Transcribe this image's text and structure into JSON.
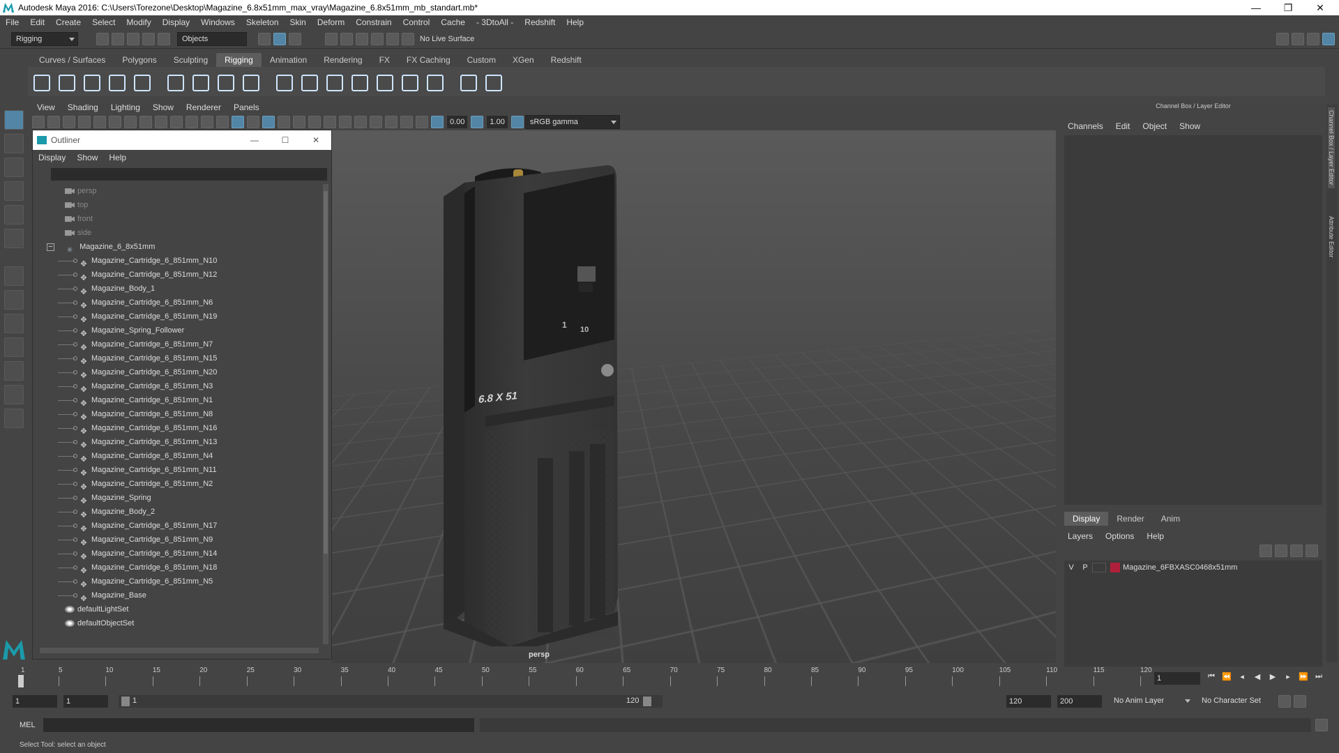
{
  "app": {
    "title": "Autodesk Maya 2016: C:\\Users\\Torezone\\Desktop\\Magazine_6.8x51mm_max_vray\\Magazine_6.8x51mm_mb_standart.mb*",
    "min": "—",
    "max": "❐",
    "close": "✕"
  },
  "menubar": [
    "File",
    "Edit",
    "Create",
    "Select",
    "Modify",
    "Display",
    "Windows",
    "Skeleton",
    "Skin",
    "Deform",
    "Constrain",
    "Control",
    "Cache",
    "- 3DtoAll -",
    "Redshift",
    "Help"
  ],
  "statusline": {
    "mode": "Rigging",
    "selection_mode": "Objects",
    "live_surface": "No Live Surface"
  },
  "shelf_tabs": [
    "Curves / Surfaces",
    "Polygons",
    "Sculpting",
    "Rigging",
    "Animation",
    "Rendering",
    "FX",
    "FX Caching",
    "Custom",
    "XGen",
    "Redshift"
  ],
  "shelf_active": "Rigging",
  "panel_menu": [
    "View",
    "Shading",
    "Lighting",
    "Show",
    "Renderer",
    "Panels"
  ],
  "panel_toolbar": {
    "exposure": "0.00",
    "gamma": "1.00",
    "color_space": "sRGB gamma"
  },
  "viewport": {
    "camera": "persp",
    "mag_label": "6.8 X 51",
    "mark_1": "1",
    "mark_10": "10"
  },
  "outliner": {
    "title": "Outliner",
    "menu": [
      "Display",
      "Show",
      "Help"
    ],
    "cameras": [
      "persp",
      "top",
      "front",
      "side"
    ],
    "group": "Magazine_6_8x51mm",
    "children": [
      "Magazine_Cartridge_6_851mm_N10",
      "Magazine_Cartridge_6_851mm_N12",
      "Magazine_Body_1",
      "Magazine_Cartridge_6_851mm_N6",
      "Magazine_Cartridge_6_851mm_N19",
      "Magazine_Spring_Follower",
      "Magazine_Cartridge_6_851mm_N7",
      "Magazine_Cartridge_6_851mm_N15",
      "Magazine_Cartridge_6_851mm_N20",
      "Magazine_Cartridge_6_851mm_N3",
      "Magazine_Cartridge_6_851mm_N1",
      "Magazine_Cartridge_6_851mm_N8",
      "Magazine_Cartridge_6_851mm_N16",
      "Magazine_Cartridge_6_851mm_N13",
      "Magazine_Cartridge_6_851mm_N4",
      "Magazine_Cartridge_6_851mm_N11",
      "Magazine_Cartridge_6_851mm_N2",
      "Magazine_Spring",
      "Magazine_Body_2",
      "Magazine_Cartridge_6_851mm_N17",
      "Magazine_Cartridge_6_851mm_N9",
      "Magazine_Cartridge_6_851mm_N14",
      "Magazine_Cartridge_6_851mm_N18",
      "Magazine_Cartridge_6_851mm_N5",
      "Magazine_Base"
    ],
    "sets": [
      "defaultLightSet",
      "defaultObjectSet"
    ]
  },
  "channelbox": {
    "title": "Channel Box / Layer Editor",
    "menu": [
      "Channels",
      "Edit",
      "Object",
      "Show"
    ],
    "tabs": [
      "Display",
      "Render",
      "Anim"
    ],
    "layer_menu": [
      "Layers",
      "Options",
      "Help"
    ],
    "layer": {
      "v": "V",
      "p": "P",
      "name": "Magazine_6FBXASC0468x51mm",
      "color": "#b0203a"
    },
    "side_tabs": [
      "Channel Box / Layer Editor",
      "Attribute Editor"
    ]
  },
  "timeline": {
    "ticks": [
      "5",
      "10",
      "15",
      "20",
      "25",
      "30",
      "35",
      "40",
      "45",
      "50",
      "55",
      "60",
      "65",
      "70",
      "75",
      "80",
      "85",
      "90",
      "95",
      "100",
      "105",
      "110",
      "115",
      "120"
    ],
    "first_tick": "1",
    "current_frame": "1"
  },
  "range": {
    "start": "1",
    "playback_start": "1",
    "slider_start": "1",
    "slider_end": "120",
    "playback_end": "120",
    "end": "200",
    "anim_layer": "No Anim Layer",
    "char_set": "No Character Set"
  },
  "cmdline": {
    "lang": "MEL"
  },
  "helpline": {
    "text": "Select Tool: select an object"
  },
  "colors": {
    "accent": "#5285a6",
    "bg": "#444444"
  }
}
